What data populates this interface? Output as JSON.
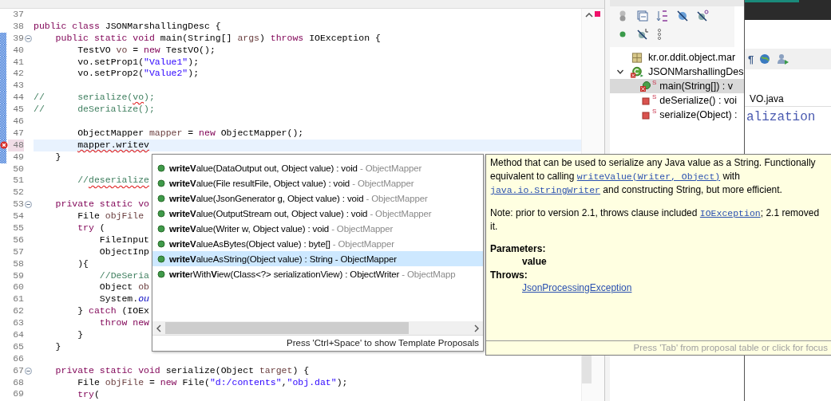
{
  "editor": {
    "lines": [
      {
        "number": "37",
        "changed": false,
        "error": false,
        "current": false,
        "fold": false
      },
      {
        "number": "38",
        "changed": false,
        "error": false,
        "current": false,
        "fold": false,
        "tokens": [
          {
            "kind": "keyword",
            "text": "public class"
          },
          {
            "kind": "plain",
            "text": " JSONMarshallingDesc {"
          }
        ]
      },
      {
        "number": "39",
        "changed": true,
        "error": false,
        "current": false,
        "fold": true,
        "tokens": [
          {
            "kind": "keyword",
            "text": "    public static void"
          },
          {
            "kind": "plain",
            "text": " main(String[] "
          },
          {
            "kind": "local",
            "text": "args"
          },
          {
            "kind": "plain",
            "text": ") "
          },
          {
            "kind": "keyword",
            "text": "throws"
          },
          {
            "kind": "plain",
            "text": " IOException {"
          }
        ]
      },
      {
        "number": "40",
        "changed": true,
        "error": false,
        "current": false,
        "fold": false,
        "tokens": [
          {
            "kind": "plain",
            "text": "        TestVO "
          },
          {
            "kind": "local",
            "text": "vo"
          },
          {
            "kind": "plain",
            "text": " = "
          },
          {
            "kind": "keyword",
            "text": "new"
          },
          {
            "kind": "plain",
            "text": " TestVO();"
          }
        ]
      },
      {
        "number": "41",
        "changed": true,
        "error": false,
        "current": false,
        "fold": false,
        "tokens": [
          {
            "kind": "plain",
            "text": "        vo.setProp1("
          },
          {
            "kind": "string",
            "text": "\"Value1\""
          },
          {
            "kind": "plain",
            "text": ");"
          }
        ]
      },
      {
        "number": "42",
        "changed": true,
        "error": false,
        "current": false,
        "fold": false,
        "tokens": [
          {
            "kind": "plain",
            "text": "        vo.setProp2("
          },
          {
            "kind": "string",
            "text": "\"Value2\""
          },
          {
            "kind": "plain",
            "text": ");"
          }
        ]
      },
      {
        "number": "43",
        "changed": true,
        "error": false,
        "current": false,
        "fold": false
      },
      {
        "number": "44",
        "changed": true,
        "error": false,
        "current": false,
        "fold": false,
        "tokens": [
          {
            "kind": "comment",
            "text": "//      serialize("
          },
          {
            "kind": "comment-misspelled",
            "text": "vo"
          },
          {
            "kind": "comment",
            "text": ");"
          }
        ]
      },
      {
        "number": "45",
        "changed": true,
        "error": false,
        "current": false,
        "fold": false,
        "tokens": [
          {
            "kind": "comment",
            "text": "//      deSerialize();"
          }
        ]
      },
      {
        "number": "46",
        "changed": true,
        "error": false,
        "current": false,
        "fold": false
      },
      {
        "number": "47",
        "changed": true,
        "error": false,
        "current": false,
        "fold": false,
        "tokens": [
          {
            "kind": "plain",
            "text": "        ObjectMapper "
          },
          {
            "kind": "local",
            "text": "mapper"
          },
          {
            "kind": "plain",
            "text": " = "
          },
          {
            "kind": "keyword",
            "text": "new"
          },
          {
            "kind": "plain",
            "text": " ObjectMapper();"
          }
        ]
      },
      {
        "number": "48",
        "changed": true,
        "error": true,
        "current": true,
        "fold": false,
        "tokens": [
          {
            "kind": "error",
            "text": "        mapper.writev"
          }
        ]
      },
      {
        "number": "49",
        "changed": true,
        "error": false,
        "current": false,
        "fold": false,
        "tokens": [
          {
            "kind": "plain",
            "text": "    }"
          }
        ]
      },
      {
        "number": "50",
        "changed": false,
        "error": false,
        "current": false,
        "fold": false
      },
      {
        "number": "51",
        "changed": false,
        "error": false,
        "current": false,
        "fold": false,
        "tokens": [
          {
            "kind": "comment",
            "text": "        //"
          },
          {
            "kind": "comment-misspelled",
            "text": "deserialize"
          }
        ]
      },
      {
        "number": "52",
        "changed": false,
        "error": false,
        "current": false,
        "fold": false
      },
      {
        "number": "53",
        "changed": false,
        "error": false,
        "current": false,
        "fold": true,
        "tokens": [
          {
            "kind": "keyword",
            "text": "    private static vo"
          }
        ]
      },
      {
        "number": "54",
        "changed": false,
        "error": false,
        "current": false,
        "fold": false,
        "tokens": [
          {
            "kind": "plain",
            "text": "        File "
          },
          {
            "kind": "local",
            "text": "objFile"
          }
        ]
      },
      {
        "number": "55",
        "changed": false,
        "error": false,
        "current": false,
        "fold": false,
        "tokens": [
          {
            "kind": "keyword",
            "text": "        try"
          },
          {
            "kind": "plain",
            "text": " ("
          }
        ]
      },
      {
        "number": "56",
        "changed": false,
        "error": false,
        "current": false,
        "fold": false,
        "tokens": [
          {
            "kind": "plain",
            "text": "            FileInput"
          }
        ]
      },
      {
        "number": "57",
        "changed": false,
        "error": false,
        "current": false,
        "fold": false,
        "tokens": [
          {
            "kind": "plain",
            "text": "            ObjectInp"
          }
        ]
      },
      {
        "number": "58",
        "changed": false,
        "error": false,
        "current": false,
        "fold": false,
        "tokens": [
          {
            "kind": "plain",
            "text": "        ){"
          }
        ]
      },
      {
        "number": "59",
        "changed": false,
        "error": false,
        "current": false,
        "fold": false,
        "tokens": [
          {
            "kind": "comment",
            "text": "            //DeSeria"
          }
        ]
      },
      {
        "number": "60",
        "changed": false,
        "error": false,
        "current": false,
        "fold": false,
        "tokens": [
          {
            "kind": "plain",
            "text": "            Object "
          },
          {
            "kind": "local",
            "text": "ob"
          }
        ]
      },
      {
        "number": "61",
        "changed": false,
        "error": false,
        "current": false,
        "fold": false,
        "tokens": [
          {
            "kind": "plain",
            "text": "            System."
          },
          {
            "kind": "field",
            "text": "ou"
          }
        ]
      },
      {
        "number": "62",
        "changed": false,
        "error": false,
        "current": false,
        "fold": false,
        "tokens": [
          {
            "kind": "plain",
            "text": "        } "
          },
          {
            "kind": "keyword",
            "text": "catch"
          },
          {
            "kind": "plain",
            "text": " (IOEx"
          }
        ]
      },
      {
        "number": "63",
        "changed": false,
        "error": false,
        "current": false,
        "fold": false,
        "tokens": [
          {
            "kind": "keyword",
            "text": "            throw new"
          }
        ]
      },
      {
        "number": "64",
        "changed": false,
        "error": false,
        "current": false,
        "fold": false,
        "tokens": [
          {
            "kind": "plain",
            "text": "        }"
          }
        ]
      },
      {
        "number": "65",
        "changed": false,
        "error": false,
        "current": false,
        "fold": false,
        "tokens": [
          {
            "kind": "plain",
            "text": "    }"
          }
        ]
      },
      {
        "number": "66",
        "changed": false,
        "error": false,
        "current": false,
        "fold": false
      },
      {
        "number": "67",
        "changed": false,
        "error": false,
        "current": false,
        "fold": true,
        "tokens": [
          {
            "kind": "keyword",
            "text": "    private static void"
          },
          {
            "kind": "plain",
            "text": " serialize(Object "
          },
          {
            "kind": "local",
            "text": "target"
          },
          {
            "kind": "plain",
            "text": ") {"
          }
        ]
      },
      {
        "number": "68",
        "changed": false,
        "error": false,
        "current": false,
        "fold": false,
        "tokens": [
          {
            "kind": "plain",
            "text": "        File "
          },
          {
            "kind": "local",
            "text": "objFile"
          },
          {
            "kind": "plain",
            "text": " = "
          },
          {
            "kind": "keyword",
            "text": "new"
          },
          {
            "kind": "plain",
            "text": " File("
          },
          {
            "kind": "string",
            "text": "\"d:/contents\""
          },
          {
            "kind": "plain",
            "text": ","
          },
          {
            "kind": "string",
            "text": "\"obj.dat\""
          },
          {
            "kind": "plain",
            "text": ");"
          }
        ]
      },
      {
        "number": "69",
        "changed": false,
        "error": false,
        "current": false,
        "fold": false,
        "tokens": [
          {
            "kind": "keyword",
            "text": "        try"
          },
          {
            "kind": "plain",
            "text": "("
          }
        ]
      }
    ]
  },
  "completion": {
    "proposals": [
      {
        "label": "**writeV**alue(DataOutput out, Object value) : void",
        "owner": "- ObjectMapper",
        "selected": false
      },
      {
        "label": "**writeV**alue(File resultFile, Object value) : void",
        "owner": "- ObjectMapper",
        "selected": false
      },
      {
        "label": "**writeV**alue(JsonGenerator g, Object value) : void",
        "owner": "- ObjectMapper",
        "selected": false
      },
      {
        "label": "**writeV**alue(OutputStream out, Object value) : void",
        "owner": "- ObjectMapper",
        "selected": false
      },
      {
        "label": "**writeV**alue(Writer w, Object value) : void",
        "owner": "- ObjectMapper",
        "selected": false
      },
      {
        "label": "**writeV**alueAsBytes(Object value) : byte[]",
        "owner": "- ObjectMapper",
        "selected": false
      },
      {
        "label": "**writeV**alueAsString(Object value) : String",
        "owner": "- ObjectMapper",
        "selected": true
      },
      {
        "label": "**write**rWith**V**iew(Class<?> serializationView) : ObjectWriter",
        "owner": "- ObjectMapp",
        "selected": false
      }
    ],
    "footer": "Press 'Ctrl+Space' to show Template Proposals"
  },
  "documentation": {
    "paragraphs": [
      [
        {
          "kind": "text",
          "text": "Method that can be used to serialize any Java value as a String. Functionally equivalent to calling "
        },
        {
          "kind": "code-link",
          "text": "writeValue(Writer, Object)"
        },
        {
          "kind": "text",
          "text": " with "
        },
        {
          "kind": "code-link",
          "text": "java.io.StringWriter"
        },
        {
          "kind": "text",
          "text": " and constructing String, but more efficient."
        }
      ],
      [
        {
          "kind": "text",
          "text": "Note: prior to version 2.1, throws clause included "
        },
        {
          "kind": "code-link",
          "text": "IOException"
        },
        {
          "kind": "text",
          "text": "; 2.1 removed it."
        }
      ]
    ],
    "sections": [
      {
        "heading": "Parameters:",
        "items": [
          {
            "kind": "name",
            "text": "value"
          }
        ]
      },
      {
        "heading": "Throws:",
        "items": [
          {
            "kind": "link",
            "text": "JsonProcessingException"
          }
        ]
      }
    ],
    "footer": "Press 'Tab' from proposal table or click for focus"
  },
  "outline": {
    "items": [
      {
        "kind": "package",
        "label": "kr.or.ddit.object.mar",
        "error": false,
        "selected": false
      },
      {
        "kind": "class",
        "label": "JSONMarshallingDes",
        "error": true,
        "selected": false,
        "expanded": true,
        "children": [
          {
            "kind": "public-method",
            "modifier": "S",
            "label": "main(String[]) : v",
            "error": true,
            "selected": true
          },
          {
            "kind": "private-method",
            "modifier": "S",
            "label": "deSerialize() : voi",
            "error": false,
            "selected": false
          },
          {
            "kind": "private-method",
            "modifier": "S",
            "label": "serialize(Object) :",
            "error": false,
            "selected": false
          }
        ]
      }
    ]
  },
  "background_window": {
    "toolbar_glyph": "¶",
    "tab": "VO.java",
    "code_fragment": "alization"
  }
}
